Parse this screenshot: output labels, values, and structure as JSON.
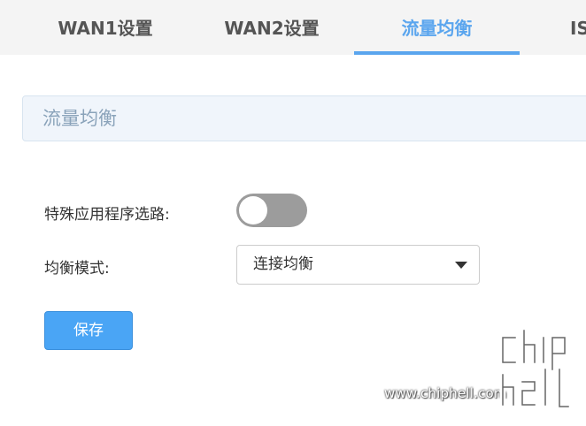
{
  "tabs": [
    {
      "label": "WAN1设置",
      "active": false
    },
    {
      "label": "WAN2设置",
      "active": false
    },
    {
      "label": "流量均衡",
      "active": true
    },
    {
      "label": "IS",
      "active": false
    }
  ],
  "section": {
    "title": "流量均衡"
  },
  "form": {
    "app_routing_label": "特殊应用程序选路:",
    "app_routing_enabled": false,
    "balance_mode_label": "均衡模式:",
    "balance_mode_value": "连接均衡"
  },
  "actions": {
    "save_label": "保存"
  },
  "watermark": {
    "url": "www.chiphell.com"
  },
  "colors": {
    "accent": "#5aa5ee",
    "button": "#4aa5f5",
    "toggle_off": "#9c9c9c"
  },
  "icons": {
    "select_caret": "caret-down-icon",
    "logo": "chiphell-logo"
  }
}
